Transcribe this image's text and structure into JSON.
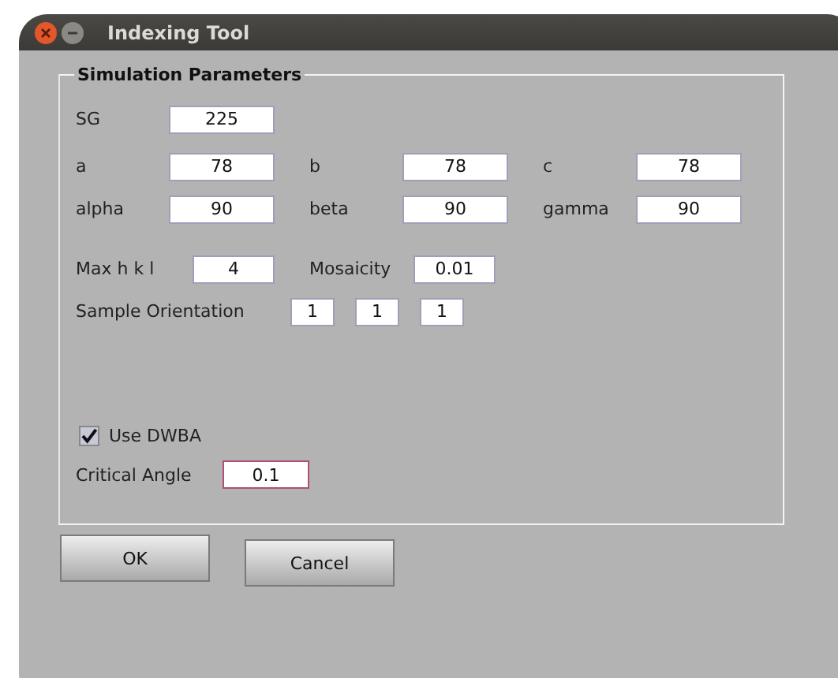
{
  "window": {
    "title": "Indexing Tool"
  },
  "group": {
    "title": "Simulation Parameters"
  },
  "sg": {
    "label": "SG",
    "value": "225"
  },
  "lattice_lengths": [
    {
      "label": "a",
      "value": "78"
    },
    {
      "label": "b",
      "value": "78"
    },
    {
      "label": "c",
      "value": "78"
    }
  ],
  "lattice_angles": [
    {
      "label": "alpha",
      "value": "90"
    },
    {
      "label": "beta",
      "value": "90"
    },
    {
      "label": "gamma",
      "value": "90"
    }
  ],
  "max_hkl": {
    "label": "Max h k l",
    "value": "4"
  },
  "mosaicity": {
    "label": "Mosaicity",
    "value": "0.01"
  },
  "sample_orientation": {
    "label": "Sample Orientation",
    "values": [
      "1",
      "1",
      "1"
    ]
  },
  "use_dwba": {
    "label": "Use DWBA",
    "checked": true
  },
  "critical_angle": {
    "label": "Critical Angle",
    "value": "0.1",
    "focused": true
  },
  "buttons": [
    {
      "label": "OK"
    },
    {
      "label": "Cancel"
    }
  ]
}
